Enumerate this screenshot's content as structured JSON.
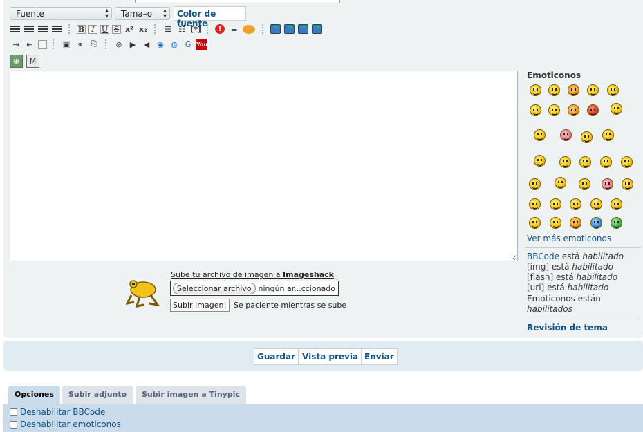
{
  "toolbar": {
    "font_select": "Fuente",
    "size_select": "Tama–o",
    "color_button": "Color de fuente",
    "bold": "B",
    "italic": "I",
    "underline": "U",
    "strike": "S",
    "superscript": "x²",
    "subscript": "x₂",
    "list_item": "[*]",
    "alert": "!"
  },
  "editor": {
    "value": ""
  },
  "smilies": {
    "title": "Emoticonos",
    "more_link": "Ver más emoticonos"
  },
  "status": {
    "bbcode_link": "BBCode",
    "esta": "está",
    "habilitado": "habilitado",
    "img": "[img]",
    "flash": "[flash]",
    "url": "[url]",
    "emoticons": "Emoticonos están",
    "habilitados": "habilitados"
  },
  "review_link": "Revisión de tema",
  "imageshack": {
    "title_prefix": "Sube tu archivo de imagen a",
    "title_brand": "Imageshack",
    "choose_button": "Seleccionar archivo",
    "file_name": "ningún ar...ccionado",
    "upload_button": "Subir Imagen!",
    "note": "Se paciente mientras se sube"
  },
  "actions": {
    "save": "Guardar",
    "preview": "Vista previa",
    "submit": "Enviar"
  },
  "tabs": [
    {
      "label": "Opciones",
      "active": true
    },
    {
      "label": "Subir adjunto"
    },
    {
      "label": "Subir imagen a Tinypic"
    }
  ],
  "options": [
    {
      "label": "Deshabilitar BBCode"
    },
    {
      "label": "Deshabilitar emoticonos"
    }
  ],
  "colors": {
    "link": "#105289",
    "panel": "#eef2f3",
    "tab_active": "#cadceb"
  }
}
